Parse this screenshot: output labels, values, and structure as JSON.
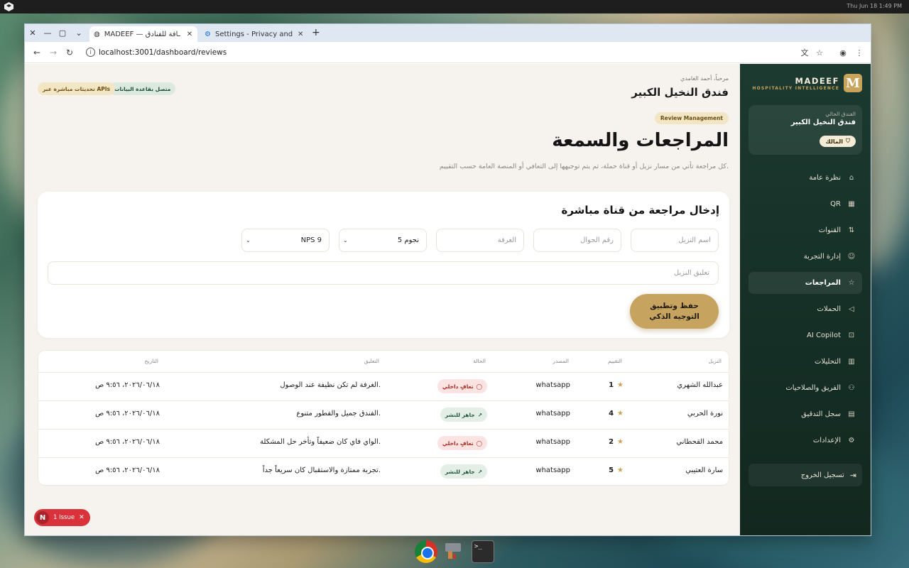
{
  "desktop": {
    "clock": "Thu Jun 18   1:49 PM"
  },
  "browser": {
    "tabs": [
      {
        "title": "MADEEF — ـافة للفنادق",
        "active": true
      },
      {
        "title": "Settings - Privacy and s",
        "active": false
      }
    ],
    "url": "localhost:3001/dashboard/reviews"
  },
  "sidebar": {
    "brand_name": "MADEEF",
    "brand_sub": "HOSPITALITY INTELLIGENCE",
    "brand_mark": "M",
    "current_hotel_label": "الفندق الحالي",
    "current_hotel_name": "فندق النخيل الكبير",
    "role": "المالك",
    "items": [
      {
        "label": "نظرة عامة",
        "icon": "home-icon"
      },
      {
        "label": "QR",
        "icon": "qr-icon"
      },
      {
        "label": "القنوات",
        "icon": "channels-icon"
      },
      {
        "label": "إدارة التجربة",
        "icon": "experience-icon"
      },
      {
        "label": "المراجعات",
        "icon": "star-icon",
        "active": true
      },
      {
        "label": "الحملات",
        "icon": "megaphone-icon"
      },
      {
        "label": "AI Copilot",
        "icon": "bot-icon"
      },
      {
        "label": "التحليلات",
        "icon": "chart-icon"
      },
      {
        "label": "الفريق والصلاحيات",
        "icon": "team-icon"
      },
      {
        "label": "سجل التدقيق",
        "icon": "audit-icon"
      },
      {
        "label": "الإعدادات",
        "icon": "gear-icon"
      }
    ],
    "logout": "تسجيل الخروج"
  },
  "header": {
    "welcome": "مرحباً، أحمد الغامدي",
    "hotel": "فندق النخيل الكبير",
    "status_db": "متصل بقاعدة البيانات",
    "status_api": "تحديثات مباشرة عبر APIs"
  },
  "page": {
    "kicker": "Review Management",
    "title": "المراجعات والسمعة",
    "description": "كل مراجعة تأتي من مسار نزيل أو قناة حملة، ثم يتم توجيهها إلى التعافي أو المنصة العامة حسب التقييم."
  },
  "form": {
    "title": "إدخال مراجعة من قناة مباشرة",
    "guest_name_placeholder": "اسم النزيل",
    "phone_placeholder": "رقم الجوال",
    "room_placeholder": "الغرفة",
    "rating_value": "5 نجوم",
    "nps_value": "NPS 9",
    "comment_placeholder": "تعليق النزيل",
    "submit_label": "حفظ وتطبيق التوجيه الذكي"
  },
  "table": {
    "headers": {
      "guest": "النزيل",
      "rating": "التقييم",
      "source": "المصدر",
      "status": "الحالة",
      "comment": "التعليق",
      "date": "التاريخ"
    },
    "rows": [
      {
        "guest": "عبدالله الشهري",
        "rating": "1",
        "source": "whatsapp",
        "status": "تعافٍ داخلي",
        "status_type": "internal",
        "comment": "الغرفة لم تكن نظيفة عند الوصول.",
        "date": "٢٠٢٦/٠٦/١٨، ٩:٥٦ ص"
      },
      {
        "guest": "نورة الحربي",
        "rating": "4",
        "source": "whatsapp",
        "status": "جاهز للنشر",
        "status_type": "ready",
        "comment": "الفندق جميل والفطور متنوع.",
        "date": "٢٠٢٦/٠٦/١٨، ٩:٥٦ ص"
      },
      {
        "guest": "محمد القحطاني",
        "rating": "2",
        "source": "whatsapp",
        "status": "تعافٍ داخلي",
        "status_type": "internal",
        "comment": "الواي فاي كان ضعيفاً وتأخر حل المشكلة.",
        "date": "٢٠٢٦/٠٦/١٨، ٩:٥٦ ص"
      },
      {
        "guest": "سارة العتيبي",
        "rating": "5",
        "source": "whatsapp",
        "status": "جاهز للنشر",
        "status_type": "ready",
        "comment": "تجربة ممتازة والاستقبال كان سريعاً جداً.",
        "date": "٢٠٢٦/٠٦/١٨، ٩:٥٦ ص"
      }
    ]
  },
  "devtools": {
    "issue_label": "1 Issue",
    "issue_mark": "N"
  },
  "colors": {
    "sidebar_bg": "#1c3a30",
    "accent_gold": "#c6a45f",
    "internal_red": "#b3261e",
    "ready_green": "#24543a"
  }
}
